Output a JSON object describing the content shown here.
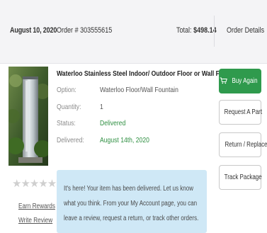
{
  "order": {
    "date": "August 10, 2020",
    "number": "Order # 303555615",
    "total_label": "Total:",
    "total_value": "$498.14",
    "details_label": "Order Details",
    "details_chevron": "›"
  },
  "product": {
    "title": "Waterloo Stainless Steel Indoor/ Outdoor Floor or Wall Fountain",
    "details": [
      {
        "label": "Option:",
        "value": "Waterloo Floor/Wall Fountain"
      },
      {
        "label": "Quantity:",
        "value": "1"
      },
      {
        "label": "Status:",
        "value": "Delivered"
      },
      {
        "label": "Delivered:",
        "value": "August 14th, 2020"
      }
    ]
  },
  "actions": {
    "buy_again": "Buy Again",
    "request_part": "Request A Part",
    "return_replace": "Return / Replace",
    "track_package": "Track Package"
  },
  "rating": {
    "stars": "★★★★★",
    "earn_rewards": "Earn Rewards",
    "write_review": "Write Review"
  },
  "notice": {
    "text": "It's here! Your item has been delivered. Let us know what you think. From your My Account page, you can leave a review, request a return, or track other orders."
  },
  "colors": {
    "buy_again": "#2f9a4d",
    "delivered": "#2f8f42",
    "notice_bg": "#cfe8f6",
    "header_bg": "#f4f4f6"
  },
  "icons": [
    "cart-icon",
    "chevron-right-icon",
    "star-icon"
  ]
}
